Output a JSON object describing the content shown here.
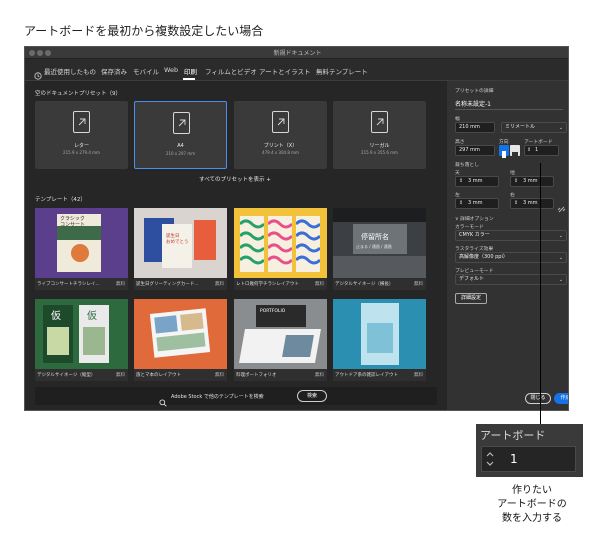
{
  "page": {
    "title": "アートボードを最初から複数設定したい場合"
  },
  "window": {
    "title": "新規ドキュメント",
    "tabs": [
      {
        "label": "最近使用したもの",
        "icon": "clock-icon"
      },
      {
        "label": "保存済み"
      },
      {
        "label": "モバイル"
      },
      {
        "label": "Web"
      },
      {
        "label": "印刷",
        "active": true
      },
      {
        "label": "フィルムとビデオ"
      },
      {
        "label": "アートとイラスト"
      },
      {
        "label": "無料テンプレート"
      }
    ]
  },
  "presets": {
    "heading": "空のドキュメントプリセット（9）",
    "items": [
      {
        "name": "レター",
        "size": "215.9 x 279.4 mm"
      },
      {
        "name": "A4",
        "size": "210 x 297 mm",
        "selected": true
      },
      {
        "name": "ブリント（X）",
        "size": "479.4 x 304.8 mm"
      },
      {
        "name": "リーガル",
        "size": "215.9 x 355.6 mm"
      }
    ],
    "show_all": "すべてのプリセットを表示 +"
  },
  "templates": {
    "heading": "テンプレート（42）",
    "items": [
      {
        "name": "ライブコンサートチラシレイ...",
        "badge": "無料"
      },
      {
        "name": "誕生日グリーティングカード...",
        "badge": "無料"
      },
      {
        "name": "レトロ幾何学チラシレイアウト",
        "badge": "無料"
      },
      {
        "name": "デジタルサイネージ（横長）",
        "badge": "無料"
      },
      {
        "name": "デジタルサイネージ（縦型）",
        "badge": "無料"
      },
      {
        "name": "旅とマ本のレイアウト",
        "badge": "無料"
      },
      {
        "name": "料理ポートフォリオ",
        "badge": "無料"
      },
      {
        "name": "アウトドア系の雑誌レイアウト",
        "badge": "無料"
      }
    ],
    "thumb_texts": {
      "concert": "クラシック\nコンサート",
      "card": "誕生日\nおめでとう",
      "station": "停留所名",
      "station2": "止まる / 通過 / 通過",
      "tag": "仮",
      "tag2": "仮",
      "portfolio": "PORTFOLIO"
    }
  },
  "search": {
    "text": "Adobe Stock で他のテンプレートを検索",
    "button": "検索"
  },
  "details": {
    "heading": "プリセットの詳細",
    "doc_name": "名称未設定-1",
    "width_label": "幅",
    "width_value": "210 mm",
    "unit_value": "ミリメートル",
    "height_label": "高さ",
    "height_value": "297 mm",
    "orientation_label": "方向",
    "artboard_label": "アートボード",
    "artboard_value": "1",
    "bleed_label": "裁ち落とし",
    "bleed_top_label": "天",
    "bleed_top": "3 mm",
    "bleed_bottom_label": "地",
    "bleed_bottom": "3 mm",
    "bleed_left_label": "左",
    "bleed_left": "3 mm",
    "bleed_right_label": "右",
    "bleed_right": "3 mm",
    "advanced_label": "∨ 詳細オプション",
    "color_mode_label": "カラーモード",
    "color_mode_value": "CMYK カラー",
    "raster_label": "ラスタライズ効果",
    "raster_value": "高解像度（300 ppi）",
    "preview_label": "プレビューモード",
    "preview_value": "デフォルト",
    "more_button": "詳細設定",
    "close_button": "閉じる",
    "create_button": "作成"
  },
  "callout": {
    "zoom_label": "アートボード",
    "zoom_value": "1",
    "note": "作りたい\nアートボードの\n数を入力する"
  },
  "colors": {
    "accent": "#1473e6",
    "selection": "#4a8ff0"
  }
}
